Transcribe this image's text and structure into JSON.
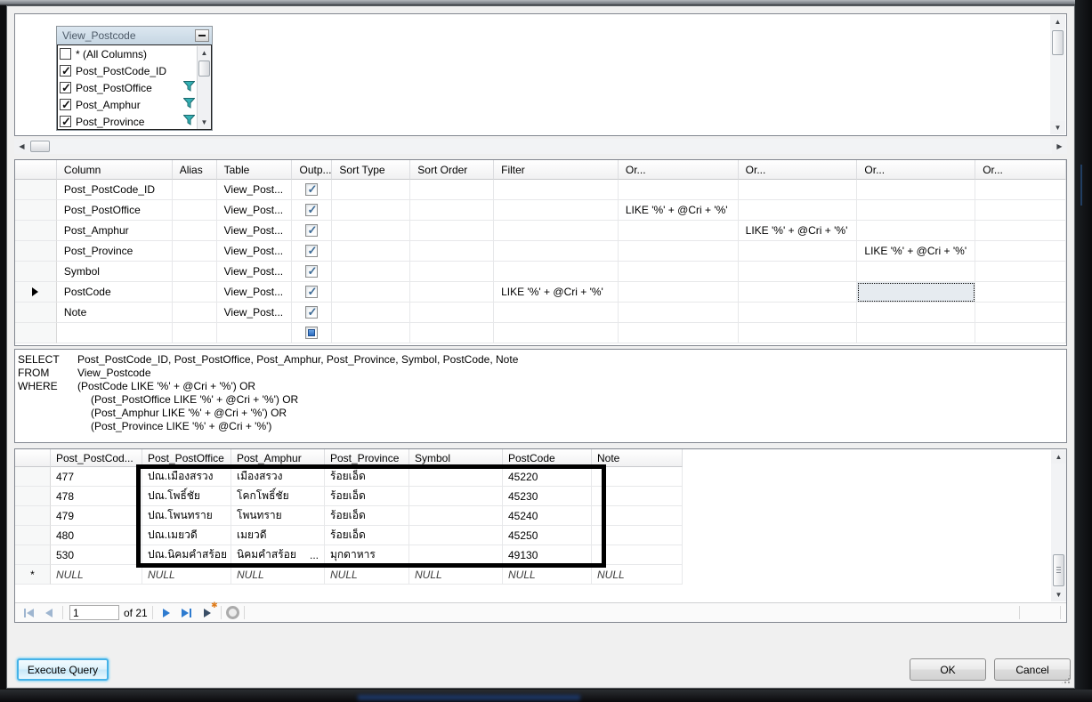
{
  "diagram": {
    "table": {
      "title": "View_Postcode",
      "columns": [
        {
          "label": "* (All Columns)",
          "checked": false,
          "filter": false
        },
        {
          "label": "Post_PostCode_ID",
          "checked": true,
          "filter": false
        },
        {
          "label": "Post_PostOffice",
          "checked": true,
          "filter": true
        },
        {
          "label": "Post_Amphur",
          "checked": true,
          "filter": true
        },
        {
          "label": "Post_Province",
          "checked": true,
          "filter": true
        }
      ]
    }
  },
  "criteria": {
    "headers": [
      "Column",
      "Alias",
      "Table",
      "Outp...",
      "Sort Type",
      "Sort Order",
      "Filter",
      "Or...",
      "Or...",
      "Or...",
      "Or..."
    ],
    "rows": [
      {
        "column": "Post_PostCode_ID",
        "alias": "",
        "table": "View_Post...",
        "output": "checked",
        "sort_type": "",
        "sort_order": "",
        "filter": "",
        "or1": "",
        "or2": "",
        "or3": "",
        "or4": ""
      },
      {
        "column": "Post_PostOffice",
        "alias": "",
        "table": "View_Post...",
        "output": "checked",
        "sort_type": "",
        "sort_order": "",
        "filter": "",
        "or1": "LIKE '%' + @Cri + '%'",
        "or2": "",
        "or3": "",
        "or4": ""
      },
      {
        "column": "Post_Amphur",
        "alias": "",
        "table": "View_Post...",
        "output": "checked",
        "sort_type": "",
        "sort_order": "",
        "filter": "",
        "or1": "",
        "or2": "LIKE '%' + @Cri + '%'",
        "or3": "",
        "or4": ""
      },
      {
        "column": "Post_Province",
        "alias": "",
        "table": "View_Post...",
        "output": "checked",
        "sort_type": "",
        "sort_order": "",
        "filter": "",
        "or1": "",
        "or2": "",
        "or3": "LIKE '%' + @Cri + '%'",
        "or4": ""
      },
      {
        "column": "Symbol",
        "alias": "",
        "table": "View_Post...",
        "output": "checked",
        "sort_type": "",
        "sort_order": "",
        "filter": "",
        "or1": "",
        "or2": "",
        "or3": "",
        "or4": ""
      },
      {
        "column": "PostCode",
        "alias": "",
        "table": "View_Post...",
        "output": "checked",
        "sort_type": "",
        "sort_order": "",
        "filter": "LIKE '%' + @Cri + '%'",
        "or1": "",
        "or2": "",
        "or3": "",
        "or4": "",
        "current": true,
        "selected_cell": "or3"
      },
      {
        "column": "Note",
        "alias": "",
        "table": "View_Post...",
        "output": "checked",
        "sort_type": "",
        "sort_order": "",
        "filter": "",
        "or1": "",
        "or2": "",
        "or3": "",
        "or4": ""
      },
      {
        "column": "",
        "alias": "",
        "table": "",
        "output": "indeterminate",
        "sort_type": "",
        "sort_order": "",
        "filter": "",
        "or1": "",
        "or2": "",
        "or3": "",
        "or4": ""
      }
    ]
  },
  "sql": {
    "lines": [
      {
        "keyword": "SELECT",
        "text": "Post_PostCode_ID, Post_PostOffice, Post_Amphur, Post_Province, Symbol, PostCode, Note",
        "indent": 0
      },
      {
        "keyword": "FROM",
        "text": "View_Postcode",
        "indent": 0
      },
      {
        "keyword": "WHERE",
        "text": "(PostCode LIKE '%' + @Cri + '%') OR",
        "indent": 0
      },
      {
        "keyword": "",
        "text": "(Post_PostOffice LIKE '%' + @Cri + '%') OR",
        "indent": 1
      },
      {
        "keyword": "",
        "text": "(Post_Amphur LIKE '%' + @Cri + '%') OR",
        "indent": 1
      },
      {
        "keyword": "",
        "text": "(Post_Province LIKE '%' + @Cri + '%')",
        "indent": 1
      }
    ]
  },
  "results": {
    "headers": [
      "Post_PostCod...",
      "Post_PostOffice",
      "Post_Amphur",
      "Post_Province",
      "Symbol",
      "PostCode",
      "Note"
    ],
    "rows": [
      {
        "cells": [
          "477",
          "ปณ.เมืองสรวง",
          "เมืองสรวง",
          "ร้อยเอ็ด",
          "",
          "45220",
          ""
        ]
      },
      {
        "cells": [
          "478",
          "ปณ.โพธิ์ชัย",
          "โคกโพธิ์ชัย",
          "ร้อยเอ็ด",
          "",
          "45230",
          ""
        ]
      },
      {
        "cells": [
          "479",
          "ปณ.โพนทราย",
          "โพนทราย",
          "ร้อยเอ็ด",
          "",
          "45240",
          ""
        ]
      },
      {
        "cells": [
          "480",
          "ปณ.เมยวดี",
          "เมยวดี",
          "ร้อยเอ็ด",
          "",
          "45250",
          ""
        ]
      },
      {
        "cells": [
          "530",
          "ปณ.นิคมคำสร้อย",
          "นิคมคำสร้อย",
          "มุกดาหาร",
          "",
          "49130",
          ""
        ],
        "truncated_cell": 2,
        "truncation_mark": "..."
      }
    ],
    "new_row": {
      "marker": "*",
      "value": "NULL"
    }
  },
  "navigator": {
    "position": "1",
    "count_label": "of 21"
  },
  "buttons": {
    "execute": "Execute Query",
    "ok": "OK",
    "cancel": "Cancel"
  },
  "colors": {
    "nav_enabled": "#2e7bcf",
    "nav_disabled": "#9fb6d0",
    "filter_icon": "#35b0b4",
    "annotation": "#000000",
    "check": "#3f6c96",
    "execute_glow": "#45b2e8"
  }
}
